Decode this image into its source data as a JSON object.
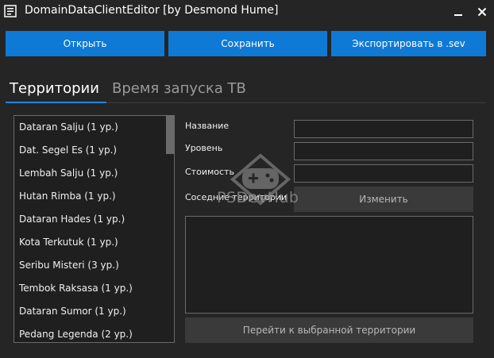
{
  "window": {
    "title": "DomainDataClientEditor [by Desmond Hume]",
    "icons": {
      "app": "app-icon",
      "minimize": "minimize-icon",
      "close": "close-icon"
    }
  },
  "toolbar": {
    "open_label": "Открыть",
    "save_label": "Сохранить",
    "export_label": "Экспортировать в .sev",
    "accent_color": "#0e7ad6"
  },
  "tabs": [
    {
      "label": "Территории",
      "active": true
    },
    {
      "label": "Время запуска ТВ",
      "active": false
    }
  ],
  "territory_list": {
    "items": [
      "Dataran Salju (1 ур.)",
      "Dat. Segel Es (1 ур.)",
      "Lembah Salju (1 ур.)",
      "Hutan Rimba (1 ур.)",
      "Dataran Hades (1 ур.)",
      "Kota Terkutuk (1 ур.)",
      "Seribu Misteri (3 ур.)",
      "Tembok Raksasa (1 ур.)",
      "Dataran Sumor (1 ур.)",
      "Pedang Legenda (2 ур.)"
    ]
  },
  "form": {
    "name_label": "Название",
    "name_value": "",
    "level_label": "Уровень",
    "level_value": "",
    "cost_label": "Стоимость",
    "cost_value": "",
    "neighbors_label": "Соседние территории",
    "change_label": "Изменить",
    "go_label": "Перейти к выбранной территории"
  },
  "watermark": {
    "text": "PSDevHub",
    "icon": "gamepad-icon"
  }
}
